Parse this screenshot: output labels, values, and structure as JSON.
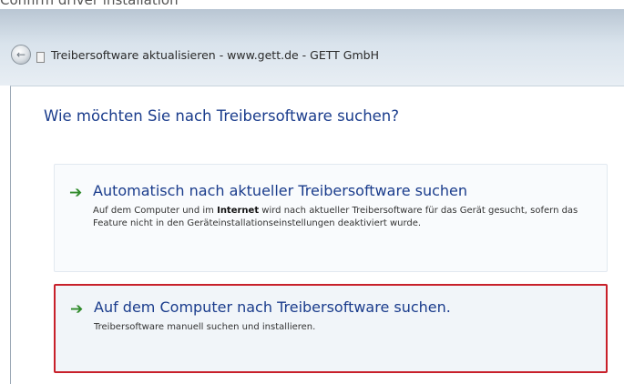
{
  "caption": "Confirm driver installation",
  "window": {
    "title": "Treibersoftware aktualisieren - www.gett.de - GETT GmbH",
    "back_glyph": "←"
  },
  "heading": "Wie möchten Sie nach Treibersoftware suchen?",
  "options": [
    {
      "icon": "green-arrow-icon",
      "arrow": "➔",
      "title": "Automatisch nach aktueller Treibersoftware suchen",
      "desc_part1": "Auf dem Computer und im ",
      "desc_bold": "Internet",
      "desc_part2": " wird nach aktueller Treibersoftware für das Gerät gesucht, sofern das Feature nicht in den Geräteinstallationseinstellungen deaktiviert wurde."
    },
    {
      "icon": "green-arrow-icon",
      "arrow": "➔",
      "title": "Auf dem Computer nach Treibersoftware suchen.",
      "desc": "Treibersoftware manuell suchen und installieren."
    }
  ],
  "colors": {
    "link_blue": "#1a3c8c",
    "arrow_green": "#2f8a2a",
    "highlight_red": "#c8202a"
  }
}
